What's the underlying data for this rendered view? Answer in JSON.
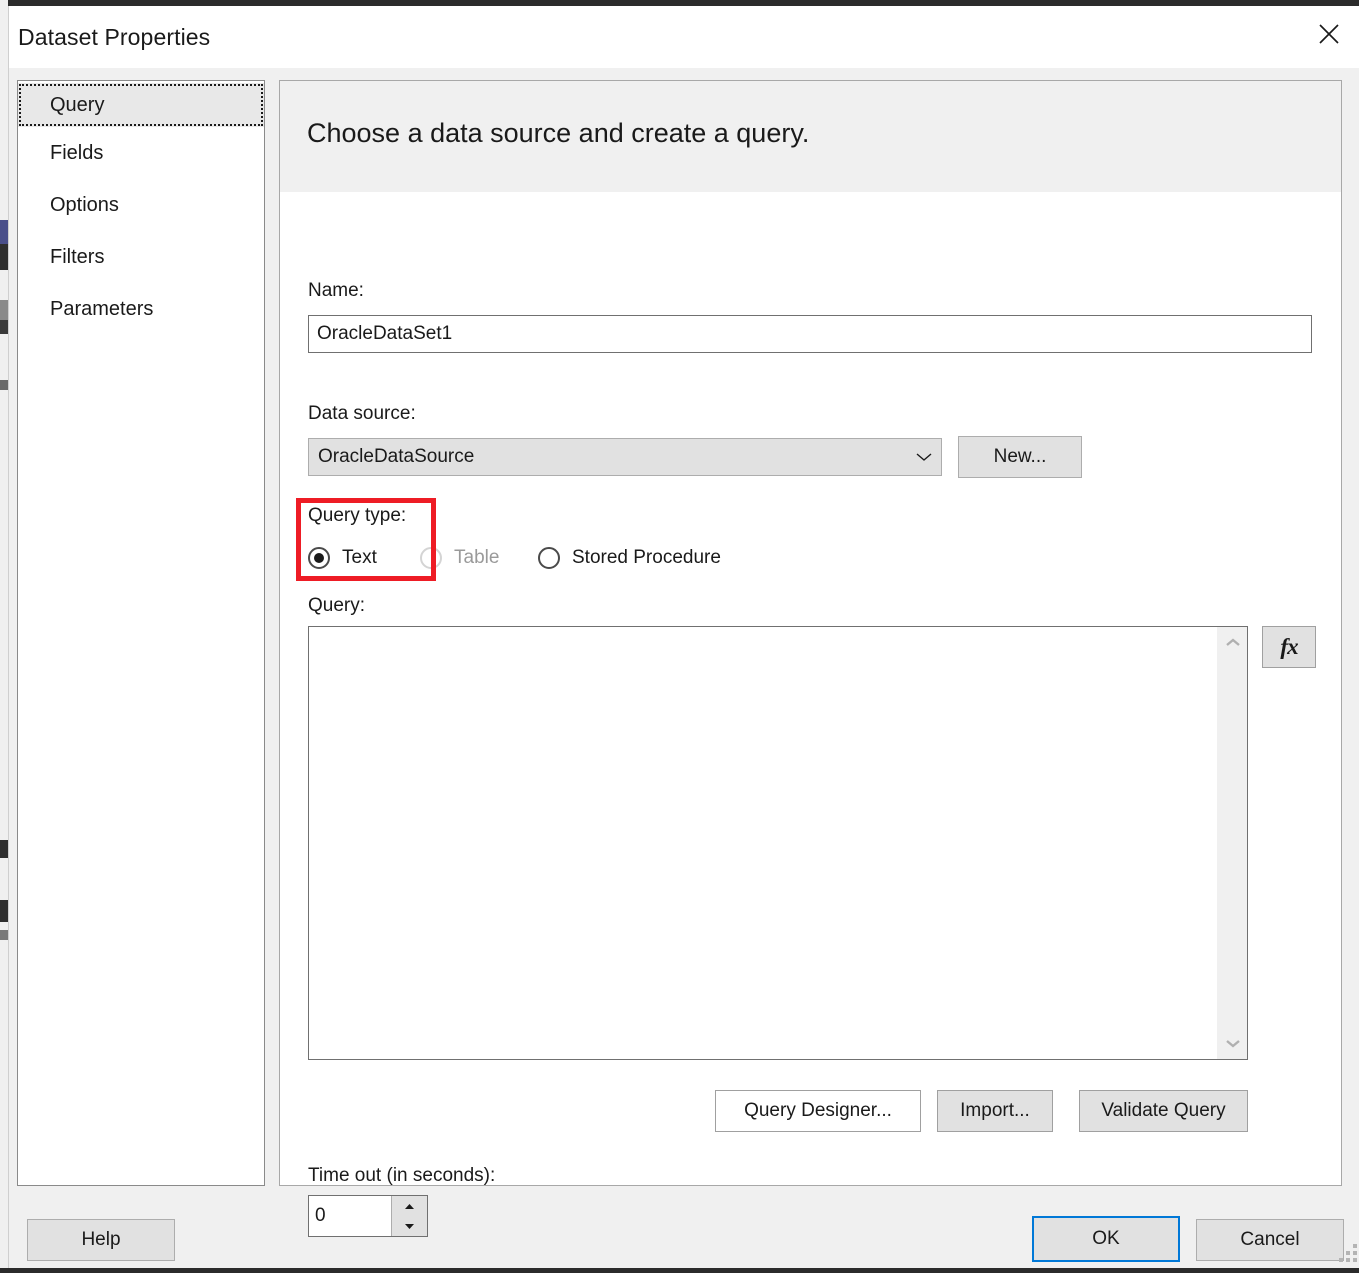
{
  "window": {
    "title": "Dataset Properties",
    "close_icon": "close-icon"
  },
  "sidebar": {
    "items": [
      {
        "label": "Query",
        "selected": true
      },
      {
        "label": "Fields",
        "selected": false
      },
      {
        "label": "Options",
        "selected": false
      },
      {
        "label": "Filters",
        "selected": false
      },
      {
        "label": "Parameters",
        "selected": false
      }
    ]
  },
  "content": {
    "header_title": "Choose a data source and create a query.",
    "name": {
      "label": "Name:",
      "value": "OracleDataSet1",
      "placeholder": ""
    },
    "data_source": {
      "label": "Data source:",
      "value": "OracleDataSource",
      "chevron_icon": "chevron-down-icon",
      "new_button": "New..."
    },
    "query_type": {
      "label": "Query type:",
      "options": [
        {
          "label": "Text",
          "selected": true,
          "disabled": false
        },
        {
          "label": "Table",
          "selected": false,
          "disabled": true
        },
        {
          "label": "Stored Procedure",
          "selected": false,
          "disabled": false
        }
      ],
      "highlight_color": "#ee1c25"
    },
    "query": {
      "label": "Query:",
      "value": "",
      "placeholder": "",
      "scroll_up_icon": "chevron-up-icon",
      "scroll_down_icon": "chevron-down-icon",
      "expression_button": "fx"
    },
    "query_buttons": {
      "query_designer": "Query Designer...",
      "import": "Import...",
      "validate_query": "Validate Query"
    },
    "timeout": {
      "label": "Time out (in seconds):",
      "value": "0",
      "increment_icon": "caret-up-icon",
      "decrement_icon": "caret-down-icon"
    }
  },
  "footer": {
    "help": "Help",
    "ok": "OK",
    "cancel": "Cancel",
    "focus_color": "#0078d7"
  }
}
